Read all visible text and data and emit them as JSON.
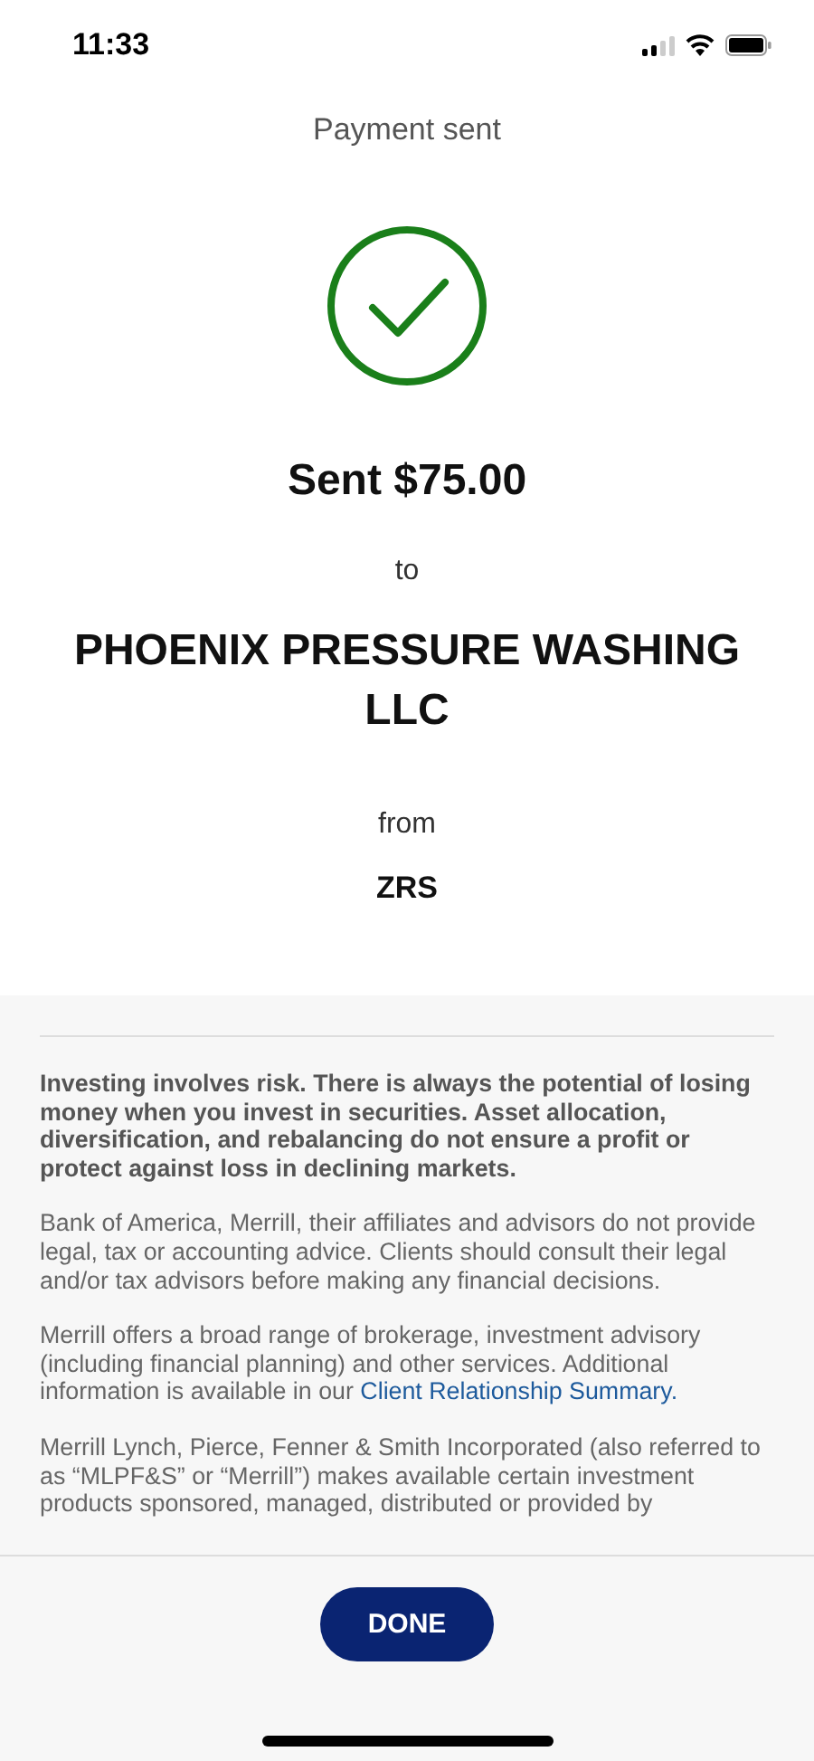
{
  "status_bar": {
    "time": "11:33"
  },
  "header": {
    "title": "Payment sent"
  },
  "confirmation": {
    "amount_line": "Sent $75.00",
    "to_label": "to",
    "payee": "PHOENIX PRESSURE WASHING LLC",
    "from_label": "from",
    "account": "ZRS"
  },
  "disclaimer": [
    {
      "text": "Investing involves risk. There is always the potential of losing money when you invest in securities. Asset allocation, diversification, and rebalancing do not ensure a profit or protect against loss in declining markets.",
      "bold": true
    },
    {
      "text": "Bank of America, Merrill, their affiliates and advisors do not provide legal, tax or accounting advice. Clients should consult their legal and/or tax advisors before making any financial decisions.",
      "bold": false
    },
    {
      "text": "Merrill offers a broad range of brokerage, investment advisory (including financial planning) and other services. Additional information is available in our",
      "link": "Client Relationship Summary.",
      "bold": false
    },
    {
      "text": "Merrill Lynch, Pierce, Fenner & Smith Incorporated (also referred to as “MLPF&S” or “Merrill”) makes available certain investment products sponsored, managed, distributed or provided by",
      "bold": false
    }
  ],
  "done_button": "DONE"
}
